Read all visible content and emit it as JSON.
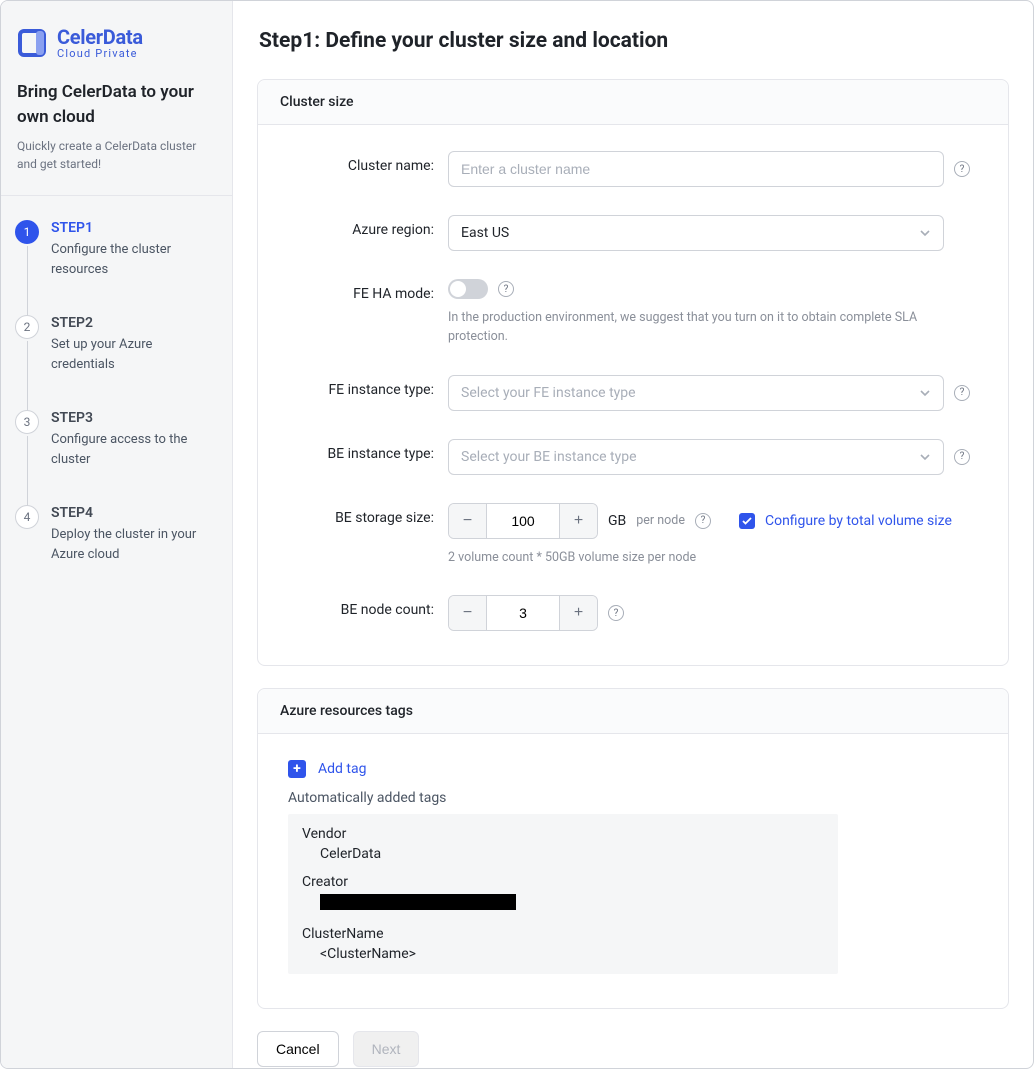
{
  "brand": {
    "name": "CelerData",
    "tagline": "Cloud  Private"
  },
  "sidebar": {
    "headline": "Bring CelerData to your own cloud",
    "subtext": "Quickly create a CelerData cluster and get started!",
    "steps": [
      {
        "num": "1",
        "title": "STEP1",
        "desc": "Configure the cluster resources",
        "active": true
      },
      {
        "num": "2",
        "title": "STEP2",
        "desc": "Set up your Azure credentials",
        "active": false
      },
      {
        "num": "3",
        "title": "STEP3",
        "desc": "Configure access to the cluster",
        "active": false
      },
      {
        "num": "4",
        "title": "STEP4",
        "desc": "Deploy the cluster in your Azure cloud",
        "active": false
      }
    ]
  },
  "page": {
    "title": "Step1: Define your cluster size and location"
  },
  "cluster": {
    "section_title": "Cluster size",
    "name_label": "Cluster name:",
    "name_placeholder": "Enter a cluster name",
    "region_label": "Azure region:",
    "region_value": "East US",
    "fe_ha_label": "FE HA mode:",
    "fe_ha_hint": "In the production environment, we suggest that you turn on it to obtain complete SLA protection.",
    "fe_type_label": "FE instance type:",
    "fe_type_placeholder": "Select your FE instance type",
    "be_type_label": "BE instance type:",
    "be_type_placeholder": "Select your BE instance type",
    "be_storage_label": "BE storage size:",
    "be_storage_value": "100",
    "be_storage_unit": "GB",
    "be_storage_pernode": "per node",
    "be_storage_checkbox_label": "Configure by total volume size",
    "be_storage_hint": "2 volume count * 50GB volume size per node",
    "be_node_label": "BE node count:",
    "be_node_value": "3"
  },
  "tags": {
    "section_title": "Azure resources tags",
    "add_label": "Add tag",
    "auto_label": "Automatically added tags",
    "items": [
      {
        "key": "Vendor",
        "val": "CelerData"
      },
      {
        "key": "Creator",
        "val": ""
      },
      {
        "key": "ClusterName",
        "val": "<ClusterName>"
      }
    ]
  },
  "footer": {
    "cancel": "Cancel",
    "next": "Next"
  }
}
